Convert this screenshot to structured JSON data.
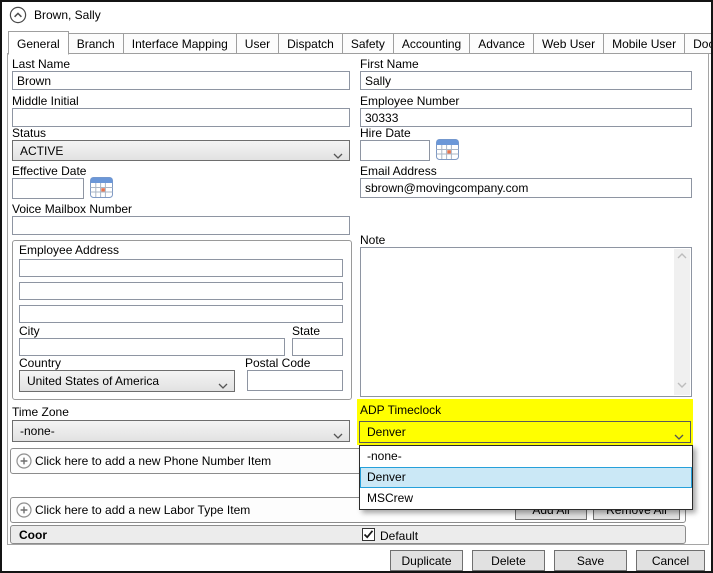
{
  "header": {
    "title": "Brown, Sally"
  },
  "tabs": [
    "General",
    "Branch",
    "Interface Mapping",
    "User",
    "Dispatch",
    "Safety",
    "Accounting",
    "Advance",
    "Web User",
    "Mobile User",
    "Documents"
  ],
  "fields": {
    "last_name": {
      "label": "Last Name",
      "value": "Brown"
    },
    "first_name": {
      "label": "First Name",
      "value": "Sally"
    },
    "middle_initial": {
      "label": "Middle Initial",
      "value": ""
    },
    "employee_number": {
      "label": "Employee Number",
      "value": "30333"
    },
    "status": {
      "label": "Status",
      "value": "ACTIVE"
    },
    "hire_date": {
      "label": "Hire Date",
      "value": ""
    },
    "effective_date": {
      "label": "Effective Date",
      "value": ""
    },
    "email": {
      "label": "Email Address",
      "value": "sbrown@movingcompany.com"
    },
    "voice_mailbox": {
      "label": "Voice Mailbox Number",
      "value": ""
    },
    "time_zone": {
      "label": "Time Zone",
      "value": "-none-"
    },
    "adp_timeclock": {
      "label": "ADP Timeclock",
      "value": "Denver"
    }
  },
  "address": {
    "group_label": "Employee Address",
    "line1": "",
    "line2": "",
    "line3": "",
    "city_label": "City",
    "city_value": "",
    "state_label": "State",
    "state_value": "",
    "country_label": "Country",
    "country_value": "United States of America",
    "postal_label": "Postal Code",
    "postal_value": ""
  },
  "note": {
    "label": "Note",
    "value": ""
  },
  "adp_dropdown": {
    "options": [
      "-none-",
      "Denver",
      "MSCrew"
    ],
    "selected": "Denver"
  },
  "expanders": {
    "phone": "Click here to add a new Phone Number Item",
    "labor": "Click here to add a new Labor Type Item"
  },
  "labor_buttons": {
    "add_all": "Add All",
    "remove_all": "Remove All"
  },
  "coor_row": {
    "title": "Coor",
    "checkbox_label": "Default",
    "checked": true
  },
  "footer_buttons": {
    "duplicate": "Duplicate",
    "delete": "Delete",
    "save": "Save",
    "cancel": "Cancel"
  },
  "colors": {
    "highlight": "#ffff00",
    "selection_bg": "#cbe8f6",
    "selection_border": "#26a0da"
  }
}
